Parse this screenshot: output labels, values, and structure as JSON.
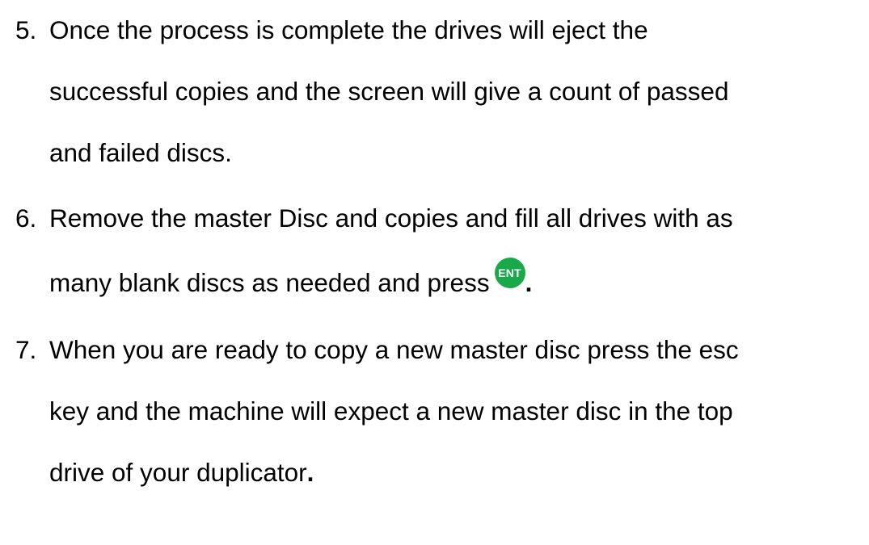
{
  "colors": {
    "text": "#000000",
    "ent_badge": "#1aa94a",
    "ent_badge_text": "#ffffff"
  },
  "steps": [
    {
      "number": "5.",
      "lines": [
        "Once the process is complete the drives will eject the",
        "successful copies and the screen will give a count of passed",
        "and failed discs."
      ]
    },
    {
      "number": "6.",
      "lines": [
        "Remove the master Disc and copies and fill all drives with as",
        "many blank discs as needed and press"
      ],
      "ent_label": "ENT",
      "trailing": "."
    },
    {
      "number": "7.",
      "lines": [
        "When you are ready to copy a new master disc press the esc",
        "key and the machine will expect a new master disc in the top",
        "drive of your duplicator"
      ],
      "trailing": "."
    }
  ]
}
